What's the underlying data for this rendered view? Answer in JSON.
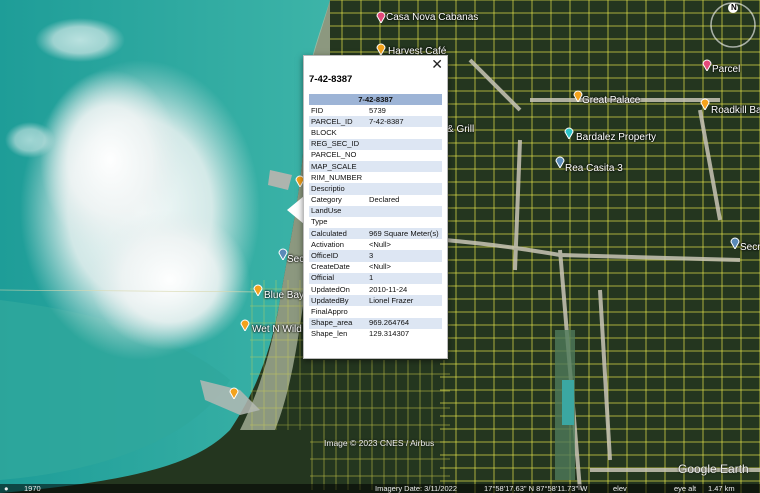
{
  "map": {
    "placemarks": [
      {
        "label": "Casa Nova Cabanas",
        "icon": "pink-pin-icon"
      },
      {
        "label": "Harvest Café",
        "icon": "orange-pin-icon"
      },
      {
        "label": "Parcel",
        "icon": "pink-pin-icon"
      },
      {
        "label": "Great Palace",
        "icon": "orange-pin-icon"
      },
      {
        "label": "Roadkill Bar",
        "icon": "orange-pin-icon"
      },
      {
        "label": "& Grill",
        "icon": ""
      },
      {
        "label": "Bardalez Property",
        "icon": "teal-pin-icon"
      },
      {
        "label": "Rea Casita 3",
        "icon": "blue-pin-icon"
      },
      {
        "label": "Sec",
        "icon": "blue-pin-icon"
      },
      {
        "label": "Secr",
        "icon": "blue-pin-icon"
      },
      {
        "label": "Blue Bayo",
        "icon": "orange-pin-icon"
      },
      {
        "label": "Wet N Wild",
        "icon": "orange-pin-icon"
      }
    ],
    "compass": "N",
    "image_credit": "Image © 2023 CNES / Airbus",
    "logo": "Google Earth",
    "colors": {
      "water": "#2aa7a0",
      "land": "#24361f",
      "parcel_lines": "#e6e64a",
      "road": "#b8b4a6"
    }
  },
  "balloon": {
    "title": "7-42-8387",
    "close": "✕",
    "table_header": "7-42-8387",
    "rows": [
      {
        "k": "FID",
        "v": "5739"
      },
      {
        "k": "PARCEL_ID",
        "v": "7-42-8387"
      },
      {
        "k": "BLOCK",
        "v": ""
      },
      {
        "k": "REG_SEC_ID",
        "v": ""
      },
      {
        "k": "PARCEL_NO",
        "v": ""
      },
      {
        "k": "MAP_SCALE",
        "v": ""
      },
      {
        "k": "RIM_NUMBER",
        "v": ""
      },
      {
        "k": "Descriptio",
        "v": ""
      },
      {
        "k": "Category",
        "v": "Declared"
      },
      {
        "k": "LandUse",
        "v": ""
      },
      {
        "k": "Type",
        "v": ""
      },
      {
        "k": "Calculated",
        "v": "969 Square Meter(s)"
      },
      {
        "k": "Activation",
        "v": "<Null>"
      },
      {
        "k": "OfficeID",
        "v": "3"
      },
      {
        "k": "CreateDate",
        "v": "<Null>"
      },
      {
        "k": "Official",
        "v": "1"
      },
      {
        "k": "UpdatedOn",
        "v": "2010-11-24"
      },
      {
        "k": "UpdatedBy",
        "v": "Lionel Frazer"
      },
      {
        "k": "FinalAppro",
        "v": ""
      },
      {
        "k": "Shape_area",
        "v": "969.264764"
      },
      {
        "k": "Shape_len",
        "v": "129.314307"
      }
    ]
  },
  "status": {
    "year": "1970",
    "imagery_date": "Imagery Date: 3/11/2022",
    "coords": "17°58'17.63\" N   87°58'11.73\" W",
    "elev": "elev",
    "eye_alt": "eye alt",
    "alt_value": "1.47 km"
  }
}
